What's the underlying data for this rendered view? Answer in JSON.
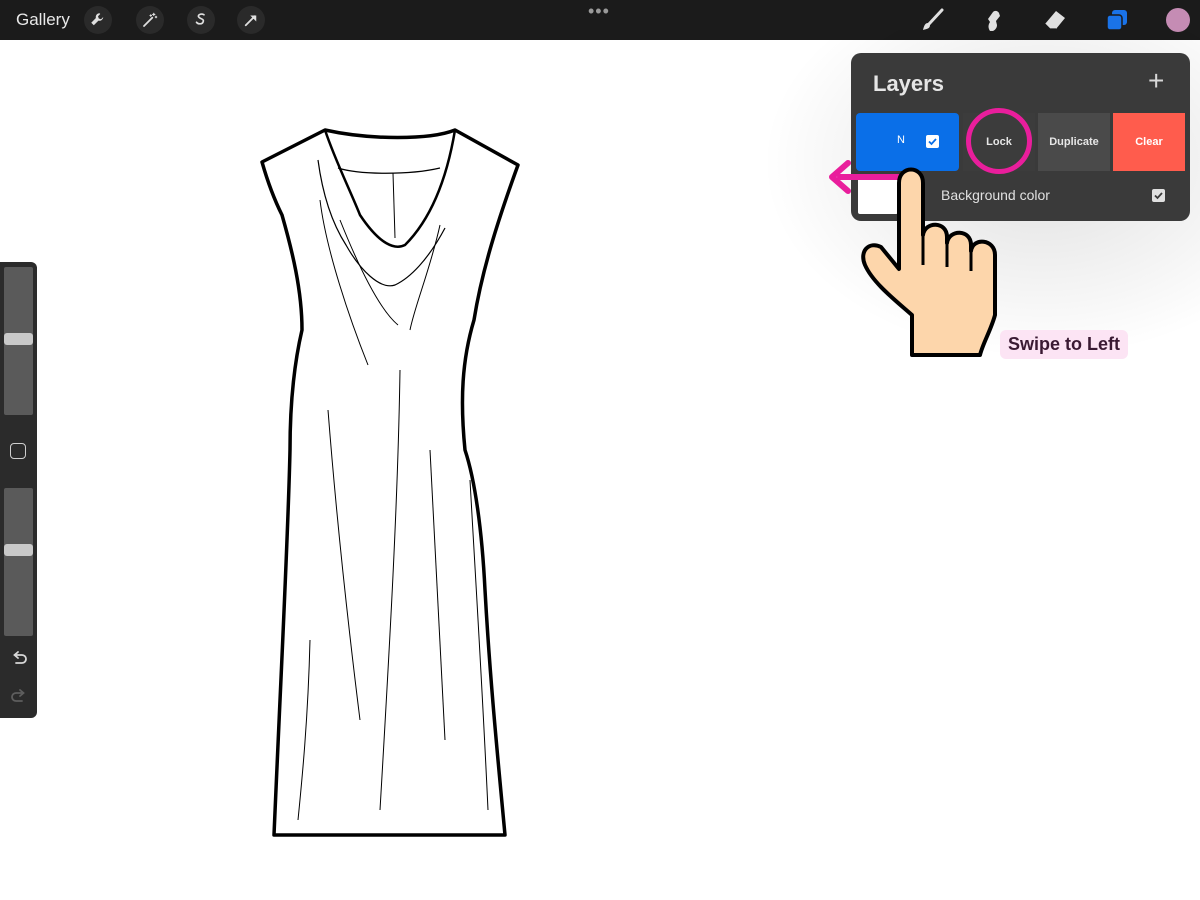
{
  "topbar": {
    "gallery_label": "Gallery",
    "menu_dots": "•••",
    "left_tools": [
      "wrench-icon",
      "magic-wand-icon",
      "selection-icon",
      "transform-arrow-icon"
    ],
    "right_tools": [
      "brush-icon",
      "smudge-icon",
      "eraser-icon",
      "layers-icon"
    ],
    "active_tool_color": "#1a73e8",
    "current_color": "#c58cb4"
  },
  "sidebar": {
    "brush_size_level": 0.5,
    "opacity_level": 0.43
  },
  "layers_panel": {
    "title": "Layers",
    "add_label": "+",
    "layer": {
      "blend_mode_label": "N",
      "visible": true
    },
    "actions": {
      "lock_label": "Lock",
      "duplicate_label": "Duplicate",
      "clear_label": "Clear"
    },
    "background": {
      "label": "Background color",
      "visible": true
    }
  },
  "gesture_hint": {
    "label": "Swipe to Left",
    "highlight_color": "#e91e9c"
  },
  "colors": {
    "panel_bg": "#3a3a3a",
    "active_layer": "#0a6fe8",
    "clear_action": "#ff5c4d"
  }
}
